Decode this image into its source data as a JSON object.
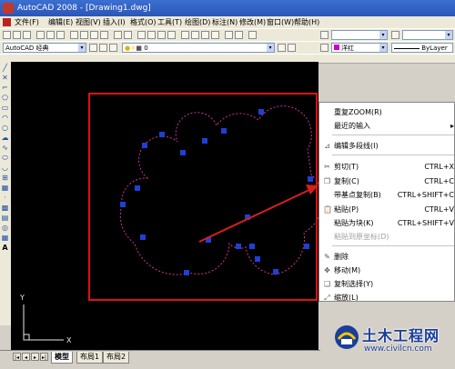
{
  "window": {
    "title": "AutoCAD 2008 - [Drawing1.dwg]"
  },
  "menu": [
    "文件(F)",
    "编辑(E)",
    "视图(V)",
    "插入(I)",
    "格式(O)",
    "工具(T)",
    "绘图(D)",
    "标注(N)",
    "修改(M)",
    "窗口(W)",
    "帮助(H)"
  ],
  "toolbar": {
    "workspace": "AutoCAD 经典",
    "layer_value": "0",
    "color_value": "洋红",
    "linetype_value": "ByLayer"
  },
  "tabs": [
    "模型",
    "布局1",
    "布局2"
  ],
  "active_tab": "模型",
  "context_menu": {
    "items": [
      {
        "label": "重复ZOOM(R)",
        "shortcut": "",
        "icon": "none",
        "disabled": false
      },
      {
        "label": "最近的输入",
        "shortcut": "▸",
        "icon": "none",
        "disabled": false
      },
      {
        "label": "编辑多段线(I)",
        "shortcut": "",
        "icon": "polyline-edit-icon",
        "disabled": false
      },
      {
        "label": "剪切(T)",
        "shortcut": "CTRL+X",
        "icon": "scissors-icon",
        "disabled": false
      },
      {
        "label": "复制(C)",
        "shortcut": "CTRL+C",
        "icon": "copy-icon",
        "disabled": false
      },
      {
        "label": "带基点复制(B)",
        "shortcut": "CTRL+SHIFT+C",
        "icon": "none",
        "disabled": false
      },
      {
        "label": "粘贴(P)",
        "shortcut": "CTRL+V",
        "icon": "paste-icon",
        "disabled": false
      },
      {
        "label": "粘贴为块(K)",
        "shortcut": "CTRL+SHIFT+V",
        "icon": "none",
        "disabled": false
      },
      {
        "label": "粘贴到原坐标(D)",
        "shortcut": "",
        "icon": "none",
        "disabled": true
      },
      {
        "label": "删除",
        "shortcut": "",
        "icon": "erase-icon",
        "disabled": false
      },
      {
        "label": "移动(M)",
        "shortcut": "",
        "icon": "move-icon",
        "disabled": false
      },
      {
        "label": "复制选择(Y)",
        "shortcut": "",
        "icon": "copy-selection-icon",
        "disabled": false
      },
      {
        "label": "缩放(L)",
        "shortcut": "",
        "icon": "scale-icon",
        "disabled": false
      }
    ]
  },
  "ucs": {
    "x_label": "X",
    "y_label": "Y"
  },
  "watermark": {
    "name": "土木工程网",
    "url": "www.civilcn.com"
  },
  "colors": {
    "selection_rect": "#e01010",
    "arrow": "#d81e1e",
    "curve": "#cc3399",
    "grip": "#1f3fd6"
  }
}
